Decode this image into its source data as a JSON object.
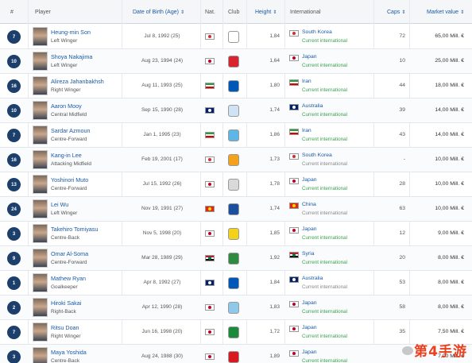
{
  "table": {
    "headers": {
      "num": "#",
      "player": "Player",
      "dob": "Date of Birth (Age)",
      "nat": "Nat.",
      "club": "Club",
      "height": "Height",
      "international": "International",
      "caps": "Caps",
      "value": "Market value"
    },
    "rows": [
      {
        "num": "7",
        "name": "Heung-min Son",
        "pos": "Left Winger",
        "dob": "Jul 8, 1992 (25)",
        "nat_flag": "korea",
        "club": "tottenham",
        "height": "1,84",
        "intl": "South Korea",
        "intl_flag": "korea",
        "status": "Current international",
        "current": true,
        "caps": "72",
        "value": "65,00 Mill. €"
      },
      {
        "num": "10",
        "name": "Shoya Nakajima",
        "pos": "Left Winger",
        "dob": "Aug 23, 1994 (24)",
        "nat_flag": "japan",
        "club": "portimonense",
        "height": "1,64",
        "intl": "Japan",
        "intl_flag": "japan",
        "status": "Current international",
        "current": true,
        "caps": "10",
        "value": "25,00 Mill. €"
      },
      {
        "num": "16",
        "name": "Alireza Jahanbakhsh",
        "pos": "Right Winger",
        "dob": "Aug 11, 1993 (25)",
        "nat_flag": "iran",
        "club": "brighton",
        "height": "1,80",
        "intl": "Iran",
        "intl_flag": "iran",
        "status": "Current international",
        "current": true,
        "caps": "44",
        "value": "18,00 Mill. €"
      },
      {
        "num": "10",
        "name": "Aaron Mooy",
        "pos": "Central Midfield",
        "dob": "Sep 15, 1990 (28)",
        "nat_flag": "australia",
        "club": "huddersfield",
        "height": "1,74",
        "intl": "Australia",
        "intl_flag": "australia",
        "status": "Current international",
        "current": true,
        "caps": "39",
        "value": "14,00 Mill. €"
      },
      {
        "num": "7",
        "name": "Sardar Azmoun",
        "pos": "Centre-Forward",
        "dob": "Jan 1, 1995 (23)",
        "nat_flag": "iran",
        "club": "zenit",
        "height": "1,86",
        "intl": "Iran",
        "intl_flag": "iran",
        "status": "Current international",
        "current": true,
        "caps": "43",
        "value": "14,00 Mill. €"
      },
      {
        "num": "16",
        "name": "Kang-in Lee",
        "pos": "Attacking Midfield",
        "dob": "Feb 19, 2001 (17)",
        "nat_flag": "korea",
        "club": "valencia",
        "height": "1,73",
        "intl": "South Korea",
        "intl_flag": "korea",
        "status": "Current international",
        "current": false,
        "caps": "-",
        "value": "10,00 Mill. €"
      },
      {
        "num": "13",
        "name": "Yoshinori Muto",
        "pos": "Centre-Forward",
        "dob": "Jul 15, 1992 (26)",
        "nat_flag": "japan",
        "club": "newcastle",
        "height": "1,78",
        "intl": "Japan",
        "intl_flag": "japan",
        "status": "Current international",
        "current": true,
        "caps": "28",
        "value": "10,00 Mill. €"
      },
      {
        "num": "24",
        "name": "Lei Wu",
        "pos": "Left Winger",
        "dob": "Nov 19, 1991 (27)",
        "nat_flag": "china",
        "club": "espanyol",
        "height": "1,74",
        "intl": "China",
        "intl_flag": "china",
        "status": "Current international",
        "current": false,
        "caps": "63",
        "value": "10,00 Mill. €"
      },
      {
        "num": "3",
        "name": "Takehiro Tomiyasu",
        "pos": "Centre-Back",
        "dob": "Nov 5, 1998 (20)",
        "nat_flag": "japan",
        "club": "stvv",
        "height": "1,85",
        "intl": "Japan",
        "intl_flag": "japan",
        "status": "Current international",
        "current": true,
        "caps": "12",
        "value": "9,00 Mill. €"
      },
      {
        "num": "9",
        "name": "Omar Al-Soma",
        "pos": "Centre-Forward",
        "dob": "Mar 28, 1989 (29)",
        "nat_flag": "syria",
        "club": "ahli",
        "height": "1,92",
        "intl": "Syria",
        "intl_flag": "syria",
        "status": "Current international",
        "current": true,
        "caps": "20",
        "value": "8,00 Mill. €"
      },
      {
        "num": "1",
        "name": "Mathew Ryan",
        "pos": "Goalkeeper",
        "dob": "Apr 8, 1992 (27)",
        "nat_flag": "australia",
        "club": "brighton",
        "height": "1,84",
        "intl": "Australia",
        "intl_flag": "australia",
        "status": "Current international",
        "current": false,
        "caps": "53",
        "value": "8,00 Mill. €"
      },
      {
        "num": "2",
        "name": "Hiroki Sakai",
        "pos": "Right-Back",
        "dob": "Apr 12, 1990 (28)",
        "nat_flag": "japan",
        "club": "marseille",
        "height": "1,83",
        "intl": "Japan",
        "intl_flag": "japan",
        "status": "Current international",
        "current": true,
        "caps": "58",
        "value": "8,00 Mill. €"
      },
      {
        "num": "7",
        "name": "Ritsu Doan",
        "pos": "Right Winger",
        "dob": "Jun 16, 1998 (20)",
        "nat_flag": "japan",
        "club": "groningen",
        "height": "1,72",
        "intl": "Japan",
        "intl_flag": "japan",
        "status": "Current international",
        "current": true,
        "caps": "35",
        "value": "7,50 Mill. €"
      },
      {
        "num": "3",
        "name": "Maya Yoshida",
        "pos": "Centre-Back",
        "dob": "Aug 24, 1988 (30)",
        "nat_flag": "japan",
        "club": "southampton",
        "height": "1,89",
        "intl": "Japan",
        "intl_flag": "japan",
        "status": "Current international",
        "current": true,
        "caps": "",
        "value": "7,00 Mill. €"
      }
    ]
  },
  "flag_colors": {
    "korea": [
      "#ffffff",
      "#ffffff",
      "#ffffff",
      "#cd2e3a"
    ],
    "japan": [
      "#ffffff",
      "#ffffff",
      "#ffffff",
      "#bc002d"
    ],
    "iran": [
      "#239f40",
      "#ffffff",
      "#da0000",
      ""
    ],
    "australia": [
      "#012169",
      "#012169",
      "#012169",
      "#ffffff"
    ],
    "china": [
      "#de2910",
      "#de2910",
      "#de2910",
      "#ffde00"
    ],
    "syria": [
      "#ce1126",
      "#ffffff",
      "#000000",
      "#007a3d"
    ]
  },
  "club_colors": {
    "tottenham": "#ffffff",
    "portimonense": "#d7242e",
    "brighton": "#0057b8",
    "huddersfield": "#cfe3f5",
    "zenit": "#5cb7e6",
    "valencia": "#f4a21b",
    "newcastle": "#d9d9d9",
    "espanyol": "#1b4fa0",
    "stvv": "#f2d21b",
    "ahli": "#2d8a3e",
    "marseille": "#8ec9ea",
    "groningen": "#1c8a3b",
    "southampton": "#d71920"
  },
  "watermark": "第4手游"
}
